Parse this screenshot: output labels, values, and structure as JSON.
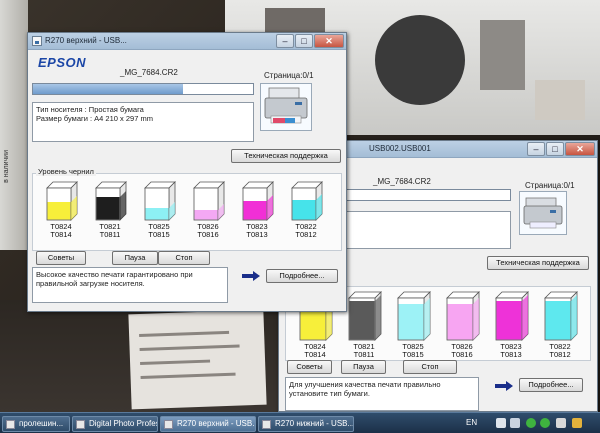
{
  "window_front": {
    "title": "R270 верхний - USB...",
    "logo": "EPSON",
    "filename": "_MG_7684.CR2",
    "page_label": "Страница:0/1",
    "progress": 0.68,
    "info_lines": [
      "Тип носителя : Простая бумага",
      "Размер бумаги : A4 210 x 297 mm"
    ],
    "support_button": "Техническая поддержка",
    "ink_group_label": "Уровень чернил",
    "inks": [
      {
        "code1": "T0824",
        "code2": "T0814",
        "color": "#f7ef3a",
        "level": 0.55
      },
      {
        "code1": "T0821",
        "code2": "T0811",
        "color": "#1e1e1e",
        "level": 0.72
      },
      {
        "code1": "T0825",
        "code2": "T0815",
        "color": "#8df0f4",
        "level": 0.38
      },
      {
        "code1": "T0826",
        "code2": "T0816",
        "color": "#f4a8f4",
        "level": 0.3
      },
      {
        "code1": "T0823",
        "code2": "T0813",
        "color": "#f12fd6",
        "level": 0.6
      },
      {
        "code1": "T0822",
        "code2": "T0812",
        "color": "#46e3ea",
        "level": 0.62
      }
    ],
    "buttons": {
      "tips": "Советы",
      "pause": "Пауза",
      "stop": "Стоп",
      "details": "Подробнее..."
    },
    "message": "Высокое качество печати гарантировано при правильной загрузке носителя."
  },
  "window_back": {
    "title": "USB002.USB001",
    "filename": "_MG_7684.CR2",
    "page_label": "Страница:0/1",
    "info_lines": [
      "бумага",
      "x 297 mm"
    ],
    "support_button": "Техническая поддержка",
    "inks": [
      {
        "code1": "T0824",
        "code2": "T0814",
        "color": "#f7ef3a",
        "level": 0.78
      },
      {
        "code1": "T0821",
        "code2": "T0811",
        "color": "#5a5a5a",
        "level": 0.92
      },
      {
        "code1": "T0825",
        "code2": "T0815",
        "color": "#9df2f6",
        "level": 0.85
      },
      {
        "code1": "T0826",
        "code2": "T0816",
        "color": "#f7a5f2",
        "level": 0.86
      },
      {
        "code1": "T0823",
        "code2": "T0813",
        "color": "#ee32d8",
        "level": 0.93
      },
      {
        "code1": "T0822",
        "code2": "T0812",
        "color": "#5ee8ee",
        "level": 0.93
      }
    ],
    "buttons": {
      "tips": "Советы",
      "pause": "Пауза",
      "stop": "Стоп",
      "details": "Подробнее..."
    },
    "message": "Для улучшения качества печати правильно установите тип бумаги."
  },
  "taskbar": {
    "items": [
      {
        "label": "пролешин..."
      },
      {
        "label": "Digital Photo Profess..."
      },
      {
        "label": "R270 верхний - USB..."
      },
      {
        "label": "R270 нижний - USB..."
      }
    ],
    "lang": "EN"
  },
  "desktop": {
    "left_strip_text": "в наличии"
  }
}
